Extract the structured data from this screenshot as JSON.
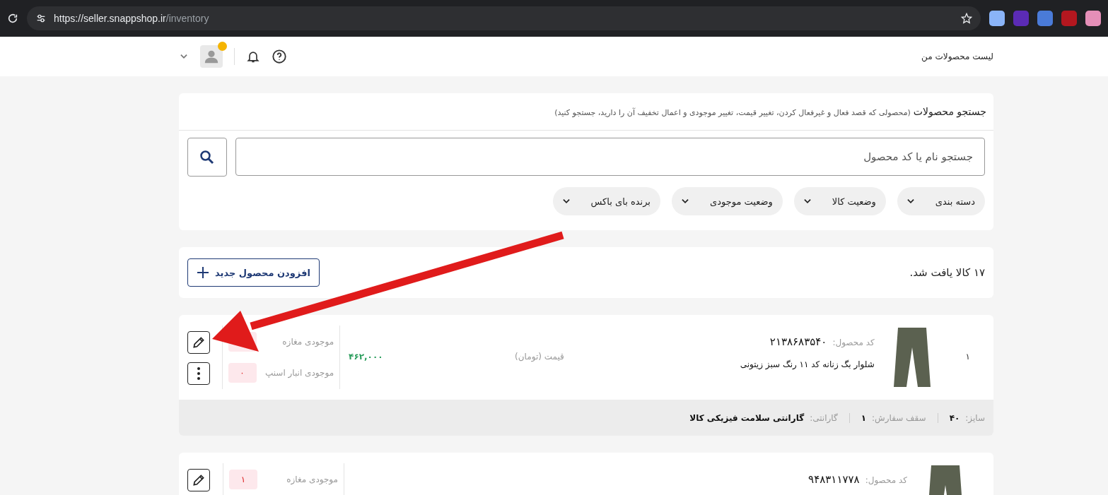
{
  "browser": {
    "url_host": "https://seller.snappshop.ir",
    "url_path": "/inventory"
  },
  "header": {
    "title": "لیست محصولات من"
  },
  "search": {
    "title": "جستجو محصولات",
    "hint": "(محصولی که قصد فعال و غیرفعال کردن، تغییر قیمت، تغییر موجودی و اعمال تخفیف آن را دارید، جستجو کنید)",
    "placeholder": "جستجو نام یا کد محصول",
    "filters": [
      "دسته بندی",
      "وضعیت کالا",
      "وضعیت موجودی",
      "برنده بای باکس"
    ]
  },
  "results": {
    "count": "۱۷ کالا یافت شد.",
    "add_button": "افزودن محصول جدید"
  },
  "products": [
    {
      "index": "۱",
      "code_label": "کد محصول:",
      "code": "۲۱۳۸۶۸۳۵۴۰",
      "name": "شلوار بگ زنانه کد ۱۱ رنگ سبز زیتونی",
      "price_label": "قیمت (تومان)",
      "price": "۴۶۲,۰۰۰",
      "stock": [
        {
          "label": "موجودی مغازه"
        },
        {
          "label": "موجودی انبار اسنپ",
          "value": "۰"
        }
      ],
      "details": [
        {
          "label": "سایز:",
          "value": "۴۰"
        },
        {
          "label": "سقف سفارش:",
          "value": "۱"
        },
        {
          "label": "گارانتی:",
          "value": "گارانتی سلامت فیزیکی کالا"
        }
      ]
    },
    {
      "code_label": "کد محصول:",
      "code": "۹۴۸۳۱۱۷۷۸",
      "stock": [
        {
          "label": "موجودی مغازه",
          "value": "۱"
        }
      ]
    }
  ],
  "annotation": {
    "kind": "arrow"
  }
}
